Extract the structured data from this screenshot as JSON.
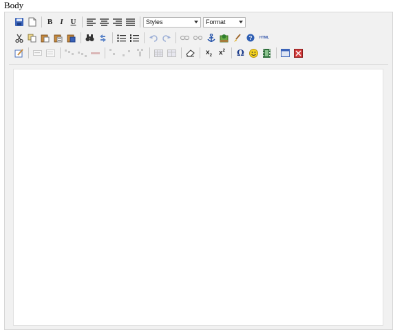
{
  "field": {
    "label": "Body"
  },
  "toolbar": {
    "bold_label": "B",
    "italic_label": "I",
    "underline_label": "U",
    "styles_select": {
      "value": "Styles"
    },
    "format_select": {
      "value": "Format"
    },
    "subscript_label": "x",
    "subscript_sub": "2",
    "superscript_label": "x",
    "superscript_sup": "2",
    "special_char_label": "Ω",
    "source_html_label": "HTML"
  },
  "colors": {
    "editor_bg": "#f1f1f1",
    "content_bg": "#ffffff",
    "accent_blue": "#2f5fb3"
  }
}
